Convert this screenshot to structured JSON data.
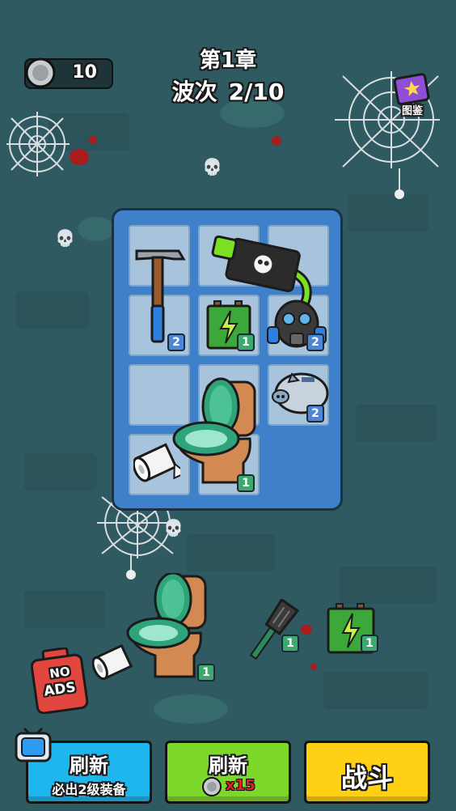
{
  "header": {
    "coins": "10",
    "chapter": "第1章",
    "wave_label": "波次",
    "wave_value": "2/10",
    "codex_label": "图鉴"
  },
  "board": {
    "cells": [
      {
        "id": "r1c1",
        "item": "hammer"
      },
      {
        "id": "r1c2",
        "item": "toxic-tank"
      },
      {
        "id": "r1c3",
        "item": ""
      },
      {
        "id": "r2c1",
        "item": "hammer",
        "level": "2"
      },
      {
        "id": "r2c2",
        "item": "battery",
        "level": "1"
      },
      {
        "id": "r2c3",
        "item": "gas-mask",
        "level": "2"
      },
      {
        "id": "r3c1",
        "item": ""
      },
      {
        "id": "r3c2",
        "item": "toilet"
      },
      {
        "id": "r3c3",
        "item": "piggy-bank",
        "level": "2"
      },
      {
        "id": "r4c1",
        "item": "toilet-paper"
      },
      {
        "id": "r4c2",
        "item": "toilet",
        "level": "1"
      }
    ]
  },
  "floor_items": [
    {
      "item": "toilet-paper"
    },
    {
      "item": "toilet",
      "level": "1"
    },
    {
      "item": "spatula",
      "level": "1"
    },
    {
      "item": "battery",
      "level": "1"
    }
  ],
  "no_ads": {
    "line1": "NO",
    "line2": "ADS"
  },
  "buttons": {
    "refresh_ad": {
      "main": "刷新",
      "sub": "必出2级装备"
    },
    "refresh_coin": {
      "main": "刷新",
      "cost": "x15"
    },
    "fight": {
      "main": "战斗"
    }
  },
  "colors": {
    "background": "#2f5a62",
    "board": "#3e80c9",
    "cell": "#a8c4dc",
    "badge_level2": "#4b87d6",
    "badge_level1": "#3daa6d",
    "btn_blue": "#1fb6ee",
    "btn_green": "#7cd82b",
    "btn_yellow": "#ffd014",
    "cost_red": "#e2202a"
  }
}
